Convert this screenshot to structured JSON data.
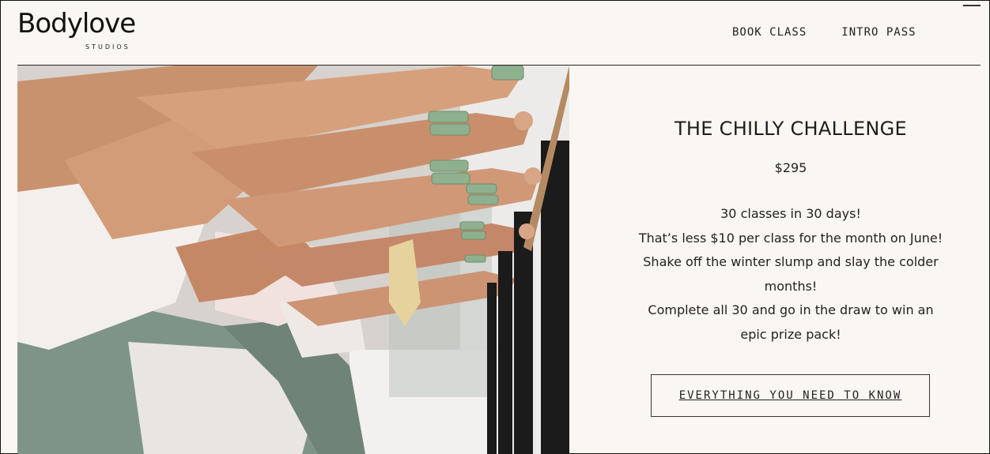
{
  "brand": {
    "name": "Bodylove",
    "sub": "STUDIOS"
  },
  "nav": {
    "items": [
      {
        "label": "BOOK CLASS"
      },
      {
        "label": "INTRO PASS"
      }
    ]
  },
  "hero": {
    "description": "",
    "colors": {
      "skin": "#c88d6b",
      "top": "#f1e6e1",
      "leggings": "#7f9488",
      "weights": "#8fb08e",
      "barre": "#1b1b1b",
      "wall": "#e2e0de"
    }
  },
  "promo": {
    "title": "THE CHILLY CHALLENGE",
    "price": "$295",
    "lines": [
      "30 classes in 30 days!",
      "That’s less $10 per class for the month on June!",
      "Shake off the winter slump and slay the colder",
      "months!",
      "Complete all 30 and go in the draw to win an",
      "epic prize pack!"
    ],
    "cta_label": "EVERYTHING YOU NEED TO KNOW"
  },
  "colors": {
    "background": "#faf6f1",
    "text": "#1d1d1d"
  }
}
